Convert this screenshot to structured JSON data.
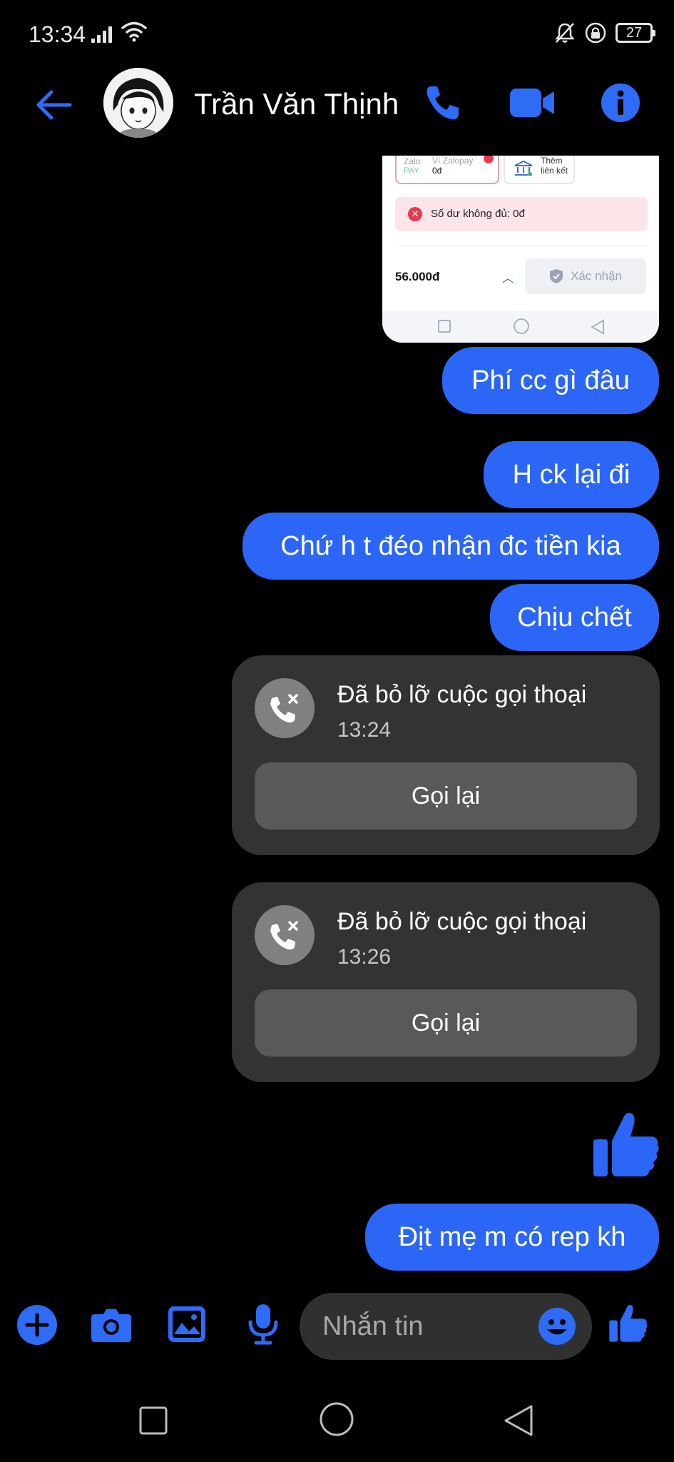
{
  "status_bar": {
    "time": "13:34",
    "battery": "27"
  },
  "header": {
    "contact_name": "Trần Văn Thịnh"
  },
  "shared_screenshot": {
    "zalo_logo_top": "Zalo",
    "zalo_logo_bottom": "PAY",
    "wallet_name": "Ví Zalopay",
    "wallet_balance": "0đ",
    "link_line1": "Thêm",
    "link_line2": "liên kết",
    "warning": "Số dư không đủ: 0đ",
    "amount": "56.000đ",
    "confirm_label": "Xác nhận"
  },
  "messages": [
    {
      "text": "Phí cc gì đâu"
    },
    {
      "text": "H ck lại đi"
    },
    {
      "text": "Chứ h t đéo nhận đc tiền kia"
    },
    {
      "text": "Chịu chết"
    },
    {
      "text": "Địt mẹ m có rep kh"
    }
  ],
  "missed_calls": [
    {
      "title": "Đã bỏ lỡ cuộc gọi thoại",
      "time": "13:24",
      "action": "Gọi lại"
    },
    {
      "title": "Đã bỏ lỡ cuộc gọi thoại",
      "time": "13:26",
      "action": "Gọi lại"
    }
  ],
  "composer": {
    "placeholder": "Nhắn tin"
  },
  "colors": {
    "accent": "#2b66f6",
    "icon_blue": "#2f6cf5",
    "call_card": "#333333"
  },
  "icons": [
    "back-arrow-icon",
    "phone-icon",
    "video-icon",
    "info-icon",
    "missed-call-icon",
    "thumbs-up-icon",
    "plus-icon",
    "camera-icon",
    "image-icon",
    "microphone-icon",
    "emoji-icon"
  ]
}
